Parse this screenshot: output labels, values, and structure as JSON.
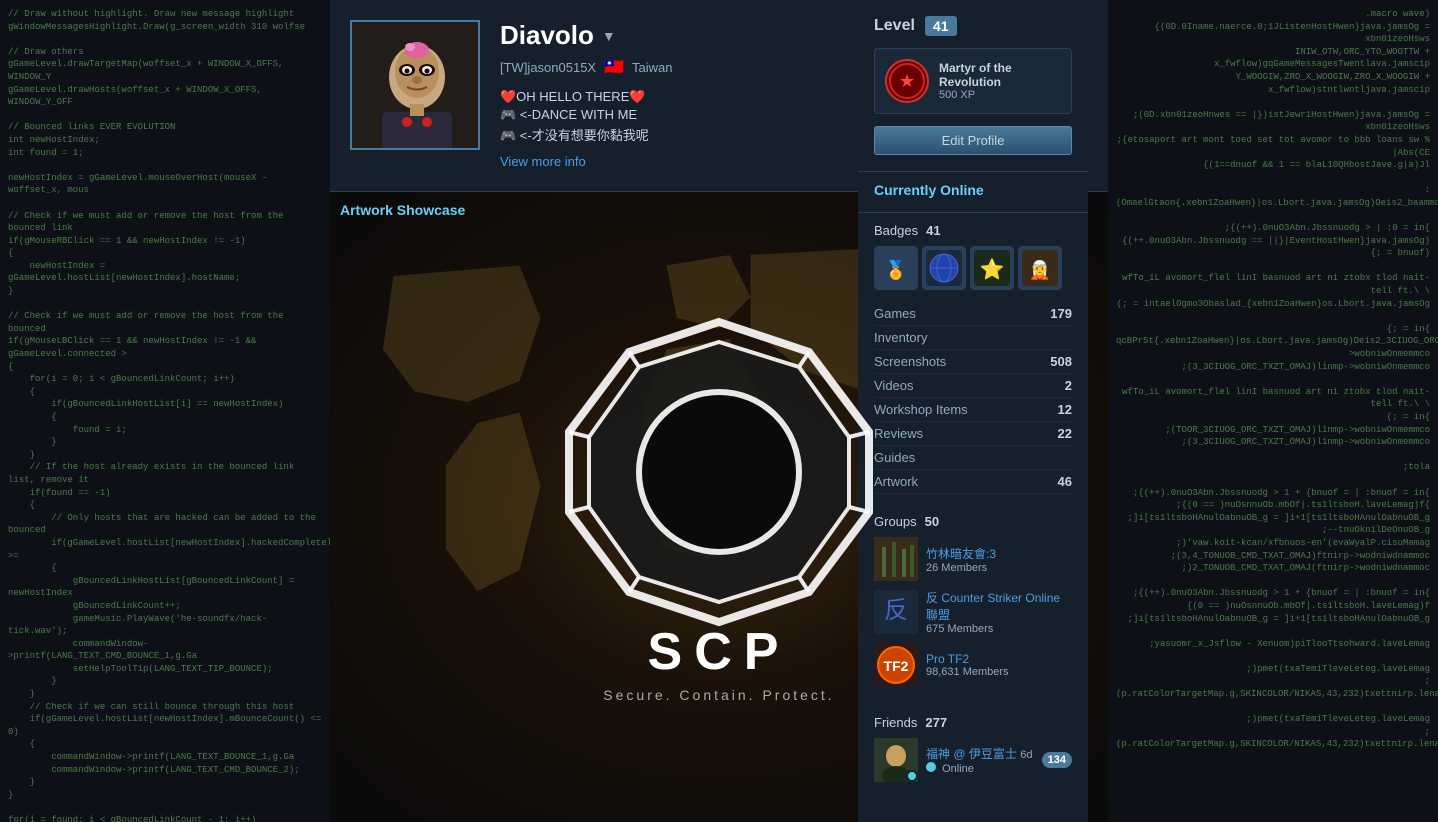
{
  "background": {
    "code_left": "// Draw without highlight. Draw new message highlight (text); \\ng.WindowMessagesHighlight.Draw(g_screen_width * 310, wolfse\\n\\n// Draw others\\ngGameLevel.drawTargetMap(woffset_x + WINDOW_X_OFFS, WINDOW_Y\\ngGameLevel.drawHosts(woffset_x + WINDOW_X_OFFS, WINDOW_Y_OFF\\n\\n// Bounced links EVER EVOLUTION\\nint newHostIndex;\\nint found = 1;\\n\\nnewHostIndex = gGameLevel.mouseOverHost(mouseX - woffset_x, mous\\n\\n// Check if we must add or remove the host from the bounced link\\nif(gMouseRBClick == 1 && newHostIndex != -1)\\n{\\n    newHostIndex = gGameLevel.hostList[newHostIndex].hostName;\\n}\\n\\n// Check if we must add or remove the host from the bounced link\\nif(gMouseLBClick == 1 && newHostIndex != -1 && gGameLevel.connected >\\n{\\n    for(i = 0; i < gBouncedLinkCount; i++)\\n    {\\n        if(gBouncedLinkHostList[i] == newHostIndex)\\n        {\\n            found = i;\\n        }\\n    }\\n    // If the host already exists in the bounced link list, remove it, othe\\n    if(found == -1)\\n    {\\n        // Only hosts that are hacked can be added to the bounced\\n        if(gGameLevel.hostList[newHostIndex].hackedCompletely2() >=\\n        {\\n            gBouncedLinkHostList[gBouncedLinkCount] = newHostIndex\\n            gBouncedLinkCount++;\\n            gameMusic.PlayWave('he-soundfx/hack-tick.wav');\\n            commandWindow->printf(LANG_TEXT_CMD_BOUNCE_1, g.Ga\\n            setHelpToolTip(LANG_TEXT_TIP_BOUNCE);\\n        }\\n    }\\n    // Check if we can still bounce through this host\\n    if(gGameLevel.hostList[newHostIndex].mBounceCount() <= 0)\\n    {\\n        commandWindow->printf(LANG_TEXT_BOUNCE_1, g.Ga\\n        commandWindow->printf(LANG_TEXT_CMD_BOUNCE_2);\\n    }\\n}\\n\\nfor(i = found; i < gBouncedLinkCount - 1; i++)\\n{\\n    gBouncedLinkHostList[i] = gBouncedLinkHostList[i] + 1;\\n    gBouncedLinkCount--;\\n    gameMusic.PlayWave('he-soundfx/hack-tick.wav');\\n    commandWindow->printf(LANG_TEXT_CMD_BOUNCE_4, 3,gGa\\n    commandWindow->printf(LANG_TEXT_CMD_BOUNCE_2);\\n}\\n\\n// Now draw the bounced links on the map\\ngGameLevel.DrawBounceLink(woffset_x + WINDOW_X_OFFS, WINDOW_Y_\\n\\ngGameLevel.drawHostToolTip(mouseX - woffset_x, mouseY);\\n\\ngGameLevel.GetLevelTimeText(temp);\\ngWindowSystemPanel.printText(232, 34, SKINCOLOR/gSkinColorTargetMap.g\\n\\n// Draw messages\\nif(gGameLevel.mActiveMessagesCount >"
  },
  "profile": {
    "username": "Diavolo",
    "user_id": "[TW]jason0515X",
    "country": "Taiwan",
    "country_flag": "🇹🇼",
    "bio_lines": [
      "❤️OH HELLO THERE❤️",
      "🎮 <-DANCE WITH ME",
      "🎮 <-才没有想要你黏我呢"
    ],
    "view_more_label": "View more info",
    "avatar_emoji": "🎭"
  },
  "level": {
    "label": "Level",
    "number": "41",
    "achievement": {
      "name": "Martyr of the Revolution",
      "xp": "500 XP",
      "icon": "🔥"
    }
  },
  "edit_profile": {
    "label": "Edit Profile"
  },
  "online": {
    "label": "Currently Online"
  },
  "badges": {
    "label": "Badges",
    "count": "41",
    "items": [
      "🏅",
      "🌐",
      "⭐",
      "🧝"
    ]
  },
  "stats": [
    {
      "label": "Games",
      "value": "179"
    },
    {
      "label": "Inventory",
      "value": ""
    },
    {
      "label": "Screenshots",
      "value": "508"
    },
    {
      "label": "Videos",
      "value": "2"
    },
    {
      "label": "Workshop Items",
      "value": "12"
    },
    {
      "label": "Reviews",
      "value": "22"
    },
    {
      "label": "Guides",
      "value": ""
    },
    {
      "label": "Artwork",
      "value": "46"
    }
  ],
  "groups": {
    "label": "Groups",
    "count": "50",
    "items": [
      {
        "name": "竹林暗友會:3",
        "members": "26 Members",
        "color": "#5a3a2a"
      },
      {
        "name": "反 Counter Striker Online 聯盟",
        "members": "675 Members",
        "color": "#2a3a5a"
      },
      {
        "name": "Pro TF2",
        "members": "98,631 Members",
        "color": "#3a2a2a"
      }
    ]
  },
  "friends": {
    "label": "Friends",
    "count": "277",
    "items": [
      {
        "name": "福神 @ 伊豆富士",
        "status": "Online",
        "time": "6d",
        "badge_count": "134",
        "is_online": true
      }
    ]
  },
  "artwork": {
    "label": "Artwork Showcase",
    "scp_tagline": "Secure. Contain. Protect."
  }
}
